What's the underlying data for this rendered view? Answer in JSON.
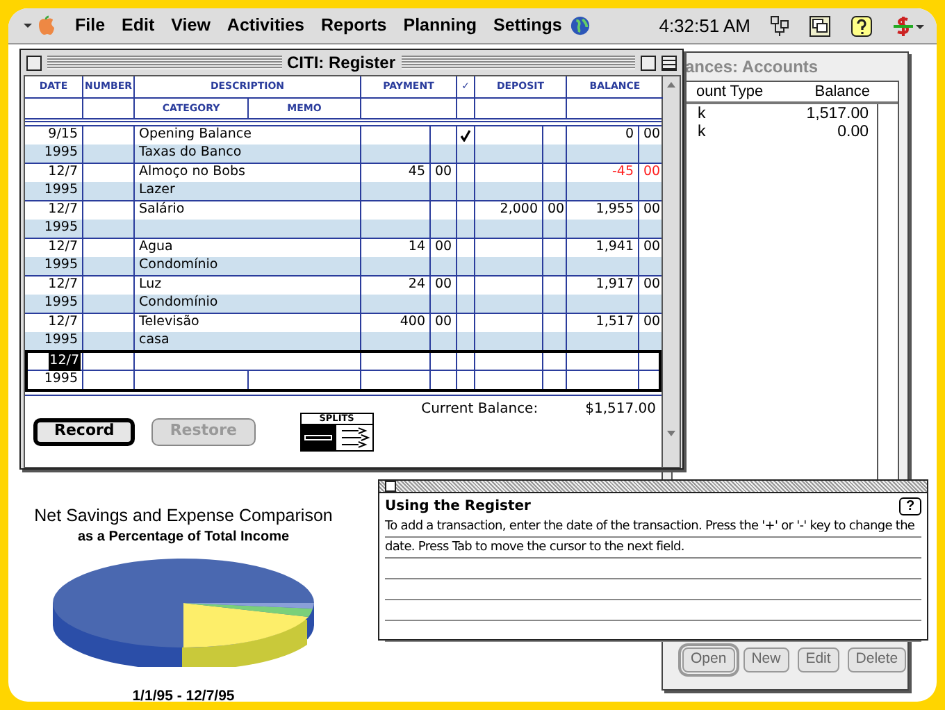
{
  "menu_bar": {
    "items": [
      "File",
      "Edit",
      "View",
      "Activities",
      "Reports",
      "Planning",
      "Settings"
    ],
    "clock": "4:32:51 AM"
  },
  "register": {
    "title": "CITI: Register",
    "columns": {
      "date": "DATE",
      "number": "NUMBER",
      "description": "DESCRIPTION",
      "category": "CATEGORY",
      "memo": "MEMO",
      "payment": "PAYMENT",
      "check": "✓",
      "deposit": "DEPOSIT",
      "balance": "BALANCE"
    },
    "rows": [
      {
        "date": "9/15",
        "year": "1995",
        "description": "Opening Balance",
        "category": "Taxas do Banco",
        "payment": "",
        "payment_cents": "",
        "cleared": true,
        "deposit": "",
        "deposit_cents": "",
        "balance": "0",
        "balance_cents": "00",
        "negative": false
      },
      {
        "date": "12/7",
        "year": "1995",
        "description": "Almoço no Bobs",
        "category": "Lazer",
        "payment": "45",
        "payment_cents": "00",
        "cleared": false,
        "deposit": "",
        "deposit_cents": "",
        "balance": "-45",
        "balance_cents": "00",
        "negative": true
      },
      {
        "date": "12/7",
        "year": "1995",
        "description": "Salário",
        "category": "",
        "payment": "",
        "payment_cents": "",
        "cleared": false,
        "deposit": "2,000",
        "deposit_cents": "00",
        "balance": "1,955",
        "balance_cents": "00",
        "negative": false
      },
      {
        "date": "12/7",
        "year": "1995",
        "description": "Agua",
        "category": "Condomínio",
        "payment": "14",
        "payment_cents": "00",
        "cleared": false,
        "deposit": "",
        "deposit_cents": "",
        "balance": "1,941",
        "balance_cents": "00",
        "negative": false
      },
      {
        "date": "12/7",
        "year": "1995",
        "description": "Luz",
        "category": "Condomínio",
        "payment": "24",
        "payment_cents": "00",
        "cleared": false,
        "deposit": "",
        "deposit_cents": "",
        "balance": "1,917",
        "balance_cents": "00",
        "negative": false
      },
      {
        "date": "12/7",
        "year": "1995",
        "description": "Televisão",
        "category": "casa",
        "payment": "400",
        "payment_cents": "00",
        "cleared": false,
        "deposit": "",
        "deposit_cents": "",
        "balance": "1,517",
        "balance_cents": "00",
        "negative": false
      }
    ],
    "new_entry": {
      "date": "12/7",
      "year": "1995",
      "selected": true
    },
    "buttons": [
      {
        "label": "Record",
        "disabled": false,
        "default": true
      },
      {
        "label": "Restore",
        "disabled": true,
        "default": false
      }
    ],
    "splits_label": "SPLITS",
    "current_balance_label": "Current Balance:",
    "current_balance": "$1,517.00"
  },
  "accounts": {
    "title": "ances: Accounts",
    "columns": [
      "ount Type",
      "Balance"
    ],
    "rows": [
      {
        "type": "k",
        "balance": "1,517.00"
      },
      {
        "type": "k",
        "balance": "0.00"
      }
    ],
    "buttons": [
      {
        "label": "Open",
        "default": true
      },
      {
        "label": "New",
        "default": false
      },
      {
        "label": "Edit",
        "default": false
      },
      {
        "label": "Delete",
        "default": false
      }
    ]
  },
  "chart": {
    "title": "Net Savings and Expense Comparison",
    "subtitle": "as a Percentage of Total Income",
    "date_range": "1/1/95 - 12/7/95"
  },
  "help": {
    "heading": "Using the Register",
    "text": "To add a transaction, enter the date of the transaction. Press the '+' or '-' key to change the date. Press Tab to move the cursor to the next field.",
    "help_button": "?"
  }
}
